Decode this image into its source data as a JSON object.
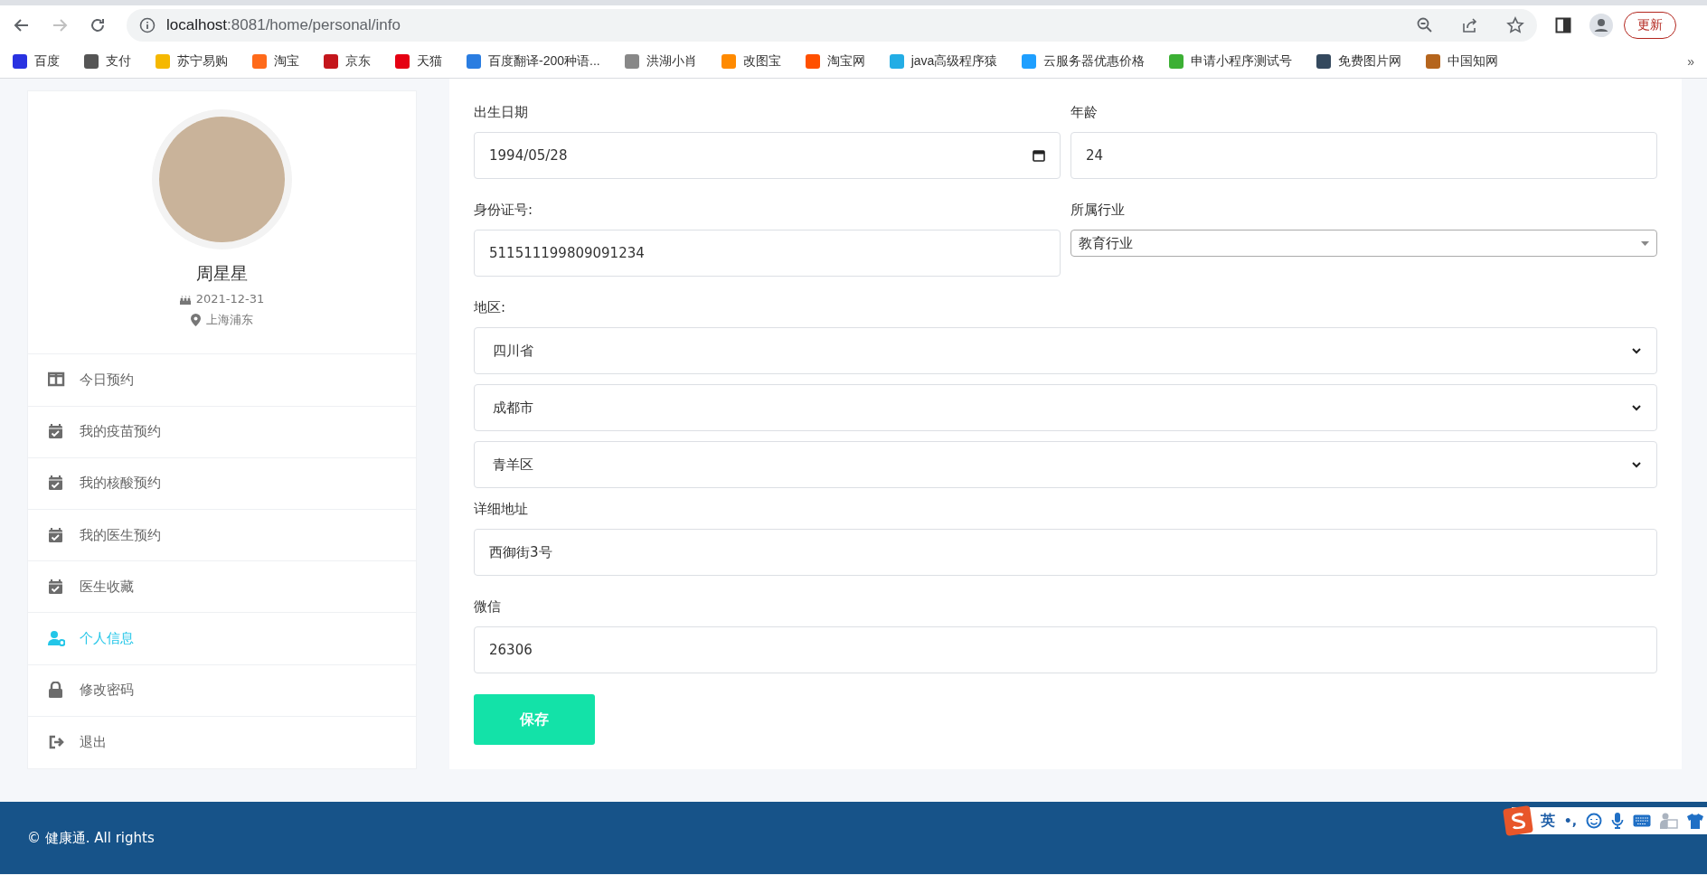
{
  "browser": {
    "back_disabled": false,
    "forward_disabled": true,
    "url_host": "localhost",
    "url_path": ":8081/home/personal/info",
    "update_button": "更新",
    "bookmarks": [
      {
        "label": "百度",
        "color": "#2932e1"
      },
      {
        "label": "支付",
        "color": "#555555"
      },
      {
        "label": "苏宁易购",
        "color": "#f5b800"
      },
      {
        "label": "淘宝",
        "color": "#ff6a1a"
      },
      {
        "label": "京东",
        "color": "#c4161c"
      },
      {
        "label": "天猫",
        "color": "#e50012"
      },
      {
        "label": "百度翻译-200种语...",
        "color": "#2a7de1"
      },
      {
        "label": "洪湖小肖",
        "color": "#888888"
      },
      {
        "label": "改图宝",
        "color": "#ff8a00"
      },
      {
        "label": "淘宝网",
        "color": "#ff5000"
      },
      {
        "label": "java高级程序猿",
        "color": "#23ade5"
      },
      {
        "label": "云服务器优惠价格",
        "color": "#1e9fff"
      },
      {
        "label": "申请小程序测试号",
        "color": "#3cb034"
      },
      {
        "label": "免费图片网",
        "color": "#34495e"
      },
      {
        "label": "中国知网",
        "color": "#b5651d"
      }
    ],
    "bookmarks_more": "»"
  },
  "profile": {
    "name": "周星星",
    "date": "2021-12-31",
    "location": "上海浦东"
  },
  "menu": [
    {
      "label": "今日预约",
      "kind": "table",
      "selected": false
    },
    {
      "label": "我的疫苗预约",
      "kind": "calendar",
      "selected": false
    },
    {
      "label": "我的核酸预约",
      "kind": "calendar",
      "selected": false
    },
    {
      "label": "我的医生预约",
      "kind": "calendar",
      "selected": false
    },
    {
      "label": "医生收藏",
      "kind": "calendar",
      "selected": false
    },
    {
      "label": "个人信息",
      "kind": "user",
      "selected": true
    },
    {
      "label": "修改密码",
      "kind": "lock",
      "selected": false
    },
    {
      "label": "退出",
      "kind": "logout",
      "selected": false
    }
  ],
  "form": {
    "rows": [
      [
        {
          "label": "出生日期",
          "kind": "date",
          "value": "1994/05/28"
        },
        {
          "label": "年龄",
          "kind": "text",
          "value": "24"
        }
      ],
      [
        {
          "label": "身份证号:",
          "kind": "text",
          "value": "511511199809091234"
        },
        {
          "label": "所属行业",
          "kind": "dropdown",
          "value": "教育行业"
        }
      ],
      [
        {
          "label": "地区:",
          "kind": "selects",
          "values": [
            "四川省",
            "成都市",
            "青羊区"
          ]
        }
      ],
      [
        {
          "label": "详细地址",
          "kind": "text",
          "value": "西御街3号"
        }
      ],
      [
        {
          "label": "微信",
          "kind": "text",
          "value": "26306"
        }
      ]
    ],
    "save_button": "保存"
  },
  "footer": {
    "text": "© 健康通. All rights"
  },
  "ime_bar": {
    "mode": "英",
    "punctuation": "•,"
  }
}
